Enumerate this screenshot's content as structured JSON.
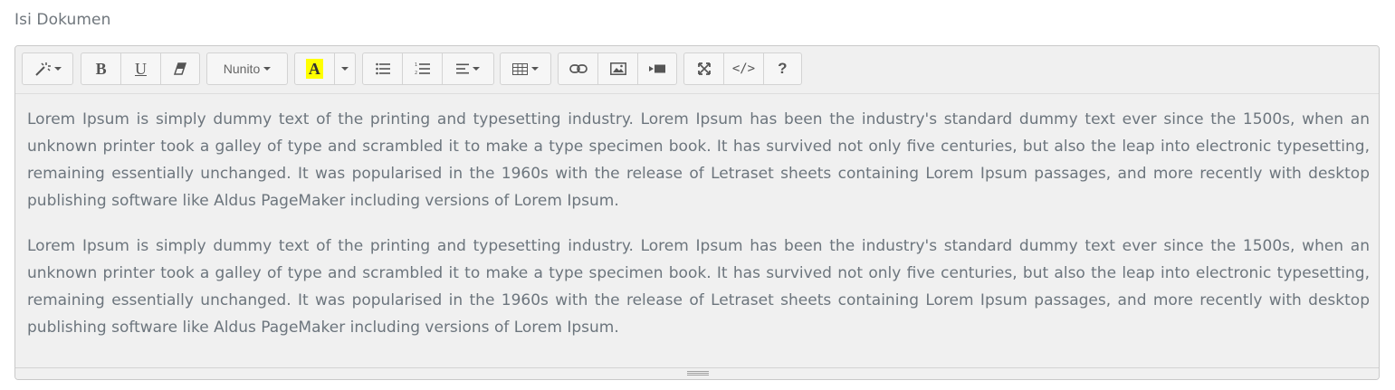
{
  "field": {
    "label": "Isi Dokumen"
  },
  "toolbar": {
    "groups": [
      {
        "name": "style",
        "buttons": [
          {
            "icon": "magic-wand-icon",
            "dropdown": true
          }
        ]
      },
      {
        "name": "font",
        "buttons": [
          {
            "icon": "bold-icon",
            "label": "B"
          },
          {
            "icon": "underline-icon",
            "label": "U"
          },
          {
            "icon": "eraser-icon"
          }
        ]
      },
      {
        "name": "fontname",
        "buttons": [
          {
            "label": "Nunito",
            "dropdown": true
          }
        ]
      },
      {
        "name": "color",
        "buttons": [
          {
            "icon": "font-color-icon",
            "label": "A",
            "highlight": "#ffff00"
          },
          {
            "icon": "color-dropdown-caret",
            "dropdown": true
          }
        ]
      },
      {
        "name": "para",
        "buttons": [
          {
            "icon": "unordered-list-icon"
          },
          {
            "icon": "ordered-list-icon"
          },
          {
            "icon": "align-icon",
            "dropdown": true
          }
        ]
      },
      {
        "name": "table",
        "buttons": [
          {
            "icon": "table-icon",
            "dropdown": true
          }
        ]
      },
      {
        "name": "insert",
        "buttons": [
          {
            "icon": "link-icon"
          },
          {
            "icon": "image-icon"
          },
          {
            "icon": "video-icon"
          }
        ]
      },
      {
        "name": "view",
        "buttons": [
          {
            "icon": "fullscreen-icon"
          },
          {
            "icon": "code-view-icon",
            "label": "</>"
          },
          {
            "icon": "help-icon",
            "label": "?"
          }
        ]
      }
    ]
  },
  "editor": {
    "paragraphs": [
      "Lorem Ipsum is simply dummy text of the printing and typesetting industry. Lorem Ipsum has been the industry's standard dummy text ever since the 1500s, when an unknown printer took a galley of type and scrambled it to make a type specimen book. It has survived not only five centuries, but also the leap into electronic typesetting, remaining essentially unchanged. It was popularised in the 1960s with the release of Letraset sheets containing Lorem Ipsum passages, and more recently with desktop publishing software like Aldus PageMaker including versions of Lorem Ipsum.",
      "Lorem Ipsum is simply dummy text of the printing and typesetting industry. Lorem Ipsum has been the industry's standard dummy text ever since the 1500s, when an unknown printer took a galley of type and scrambled it to make a type specimen book. It has survived not only five centuries, but also the leap into electronic typesetting, remaining essentially unchanged. It was popularised in the 1960s with the release of Letraset sheets containing Lorem Ipsum passages, and more recently with desktop publishing software like Aldus PageMaker including versions of Lorem Ipsum."
    ]
  },
  "colors": {
    "highlight": "#ffff00",
    "text": "#6c757d",
    "editor_bg": "#f0f0f0"
  }
}
